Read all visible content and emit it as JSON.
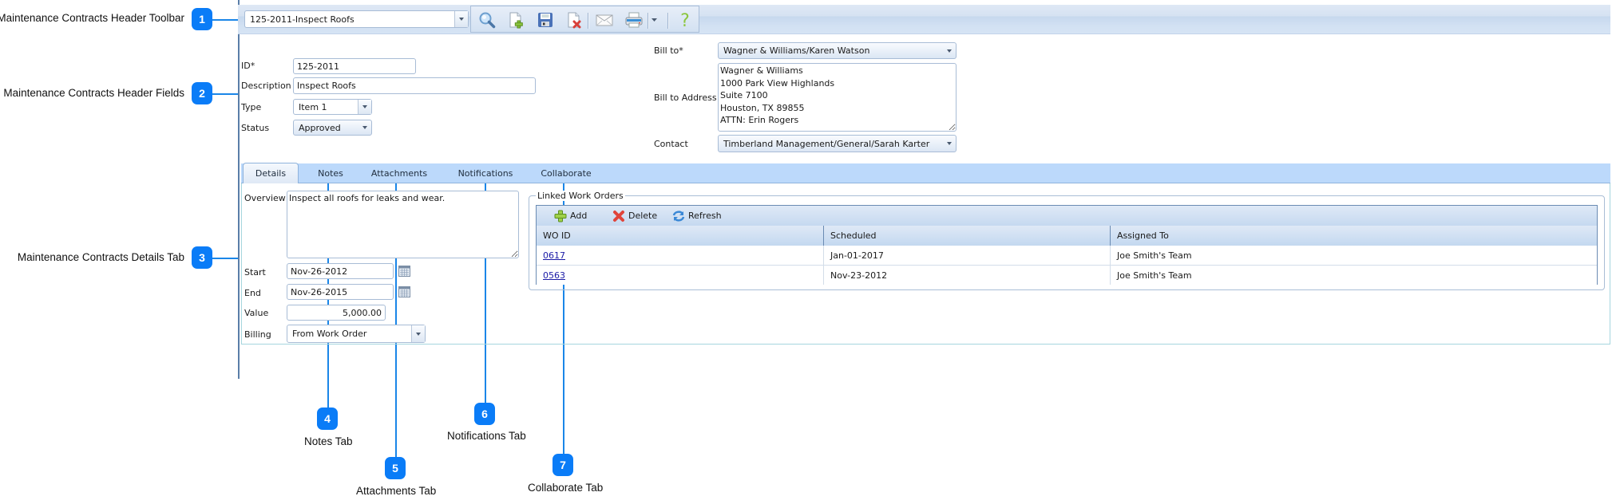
{
  "callouts": [
    {
      "number": "1",
      "label": "Maintenance Contracts Header Toolbar"
    },
    {
      "number": "2",
      "label": "Maintenance Contracts Header Fields"
    },
    {
      "number": "3",
      "label": "Maintenance Contracts Details Tab"
    },
    {
      "number": "4",
      "label": "Notes Tab"
    },
    {
      "number": "5",
      "label": "Attachments Tab"
    },
    {
      "number": "6",
      "label": "Notifications Tab"
    },
    {
      "number": "7",
      "label": "Collaborate Tab"
    }
  ],
  "toolbar": {
    "record_selector": "125-2011-Inspect Roofs",
    "buttons": [
      {
        "name": "search",
        "icon": "magnifier-icon"
      },
      {
        "name": "new",
        "icon": "new-document-icon"
      },
      {
        "name": "save",
        "icon": "floppy-disk-icon"
      },
      {
        "name": "delete",
        "icon": "delete-document-icon"
      },
      {
        "name": "email",
        "icon": "envelope-icon"
      },
      {
        "name": "print",
        "icon": "printer-icon"
      },
      {
        "name": "print-options",
        "icon": "chevron-down-icon"
      },
      {
        "name": "help",
        "icon": "question-mark-icon"
      }
    ]
  },
  "header": {
    "id_label": "ID*",
    "id_value": "125-2011",
    "description_label": "Description",
    "description_value": "Inspect Roofs",
    "type_label": "Type",
    "type_value": "Item 1",
    "status_label": "Status",
    "status_value": "Approved",
    "bill_to_label": "Bill to*",
    "bill_to_value": "Wagner & Williams/Karen Watson",
    "bill_to_address_label": "Bill to Address",
    "bill_to_address_value": "Wagner & Williams\n1000 Park View Highlands\nSuite 7100\nHouston, TX 89855\nATTN: Erin Rogers",
    "contact_label": "Contact",
    "contact_value": "Timberland Management/General/Sarah Karter"
  },
  "tabs": [
    {
      "label": "Details",
      "active": true
    },
    {
      "label": "Notes",
      "active": false
    },
    {
      "label": "Attachments",
      "active": false
    },
    {
      "label": "Notifications",
      "active": false
    },
    {
      "label": "Collaborate",
      "active": false
    }
  ],
  "details": {
    "overview_label": "Overview",
    "overview_value": "Inspect all roofs for leaks and wear.",
    "start_label": "Start",
    "start_value": "Nov-26-2012",
    "end_label": "End",
    "end_value": "Nov-26-2015",
    "value_label": "Value",
    "value_value": "5,000.00",
    "billing_label": "Billing",
    "billing_value": "From Work Order"
  },
  "linked_work_orders": {
    "title": "Linked Work Orders",
    "add_label": "Add",
    "delete_label": "Delete",
    "refresh_label": "Refresh",
    "columns": [
      "WO ID",
      "Scheduled",
      "Assigned To"
    ],
    "rows": [
      {
        "wo_id": "0617",
        "scheduled": "Jan-01-2017",
        "assigned_to": "Joe Smith's Team"
      },
      {
        "wo_id": "0563",
        "scheduled": "Nov-23-2012",
        "assigned_to": "Joe Smith's Team"
      }
    ]
  }
}
